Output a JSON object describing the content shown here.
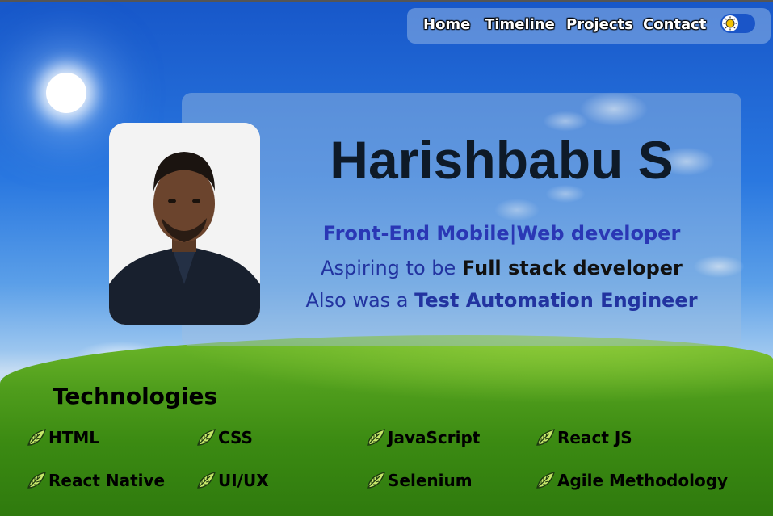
{
  "nav": {
    "items": [
      {
        "label": "Home"
      },
      {
        "label": "Timeline"
      },
      {
        "label": "Projects"
      },
      {
        "label": "Contact"
      }
    ],
    "theme_toggle_icon": "sun-icon"
  },
  "hero": {
    "name": "Harishbabu S",
    "line1": "Front-End Mobile|Web developer",
    "line2_prefix": "Aspiring to be ",
    "line2_bold": "Full stack developer",
    "line3_prefix": "Also was a ",
    "line3_bold": "Test Automation Engineer",
    "avatar": "profile-photo"
  },
  "technologies": {
    "title": "Technologies",
    "bullet_icon": "leaf-icon",
    "items": [
      "HTML",
      "CSS",
      "JavaScript",
      "React JS",
      "React Native",
      "UI/UX",
      "Selenium",
      "Agile Methodology"
    ]
  },
  "colors": {
    "sky_top": "#1757c9",
    "grass": "#4f9d1c",
    "accent_text": "#2a37b5",
    "toggle": "#1a55c8"
  }
}
